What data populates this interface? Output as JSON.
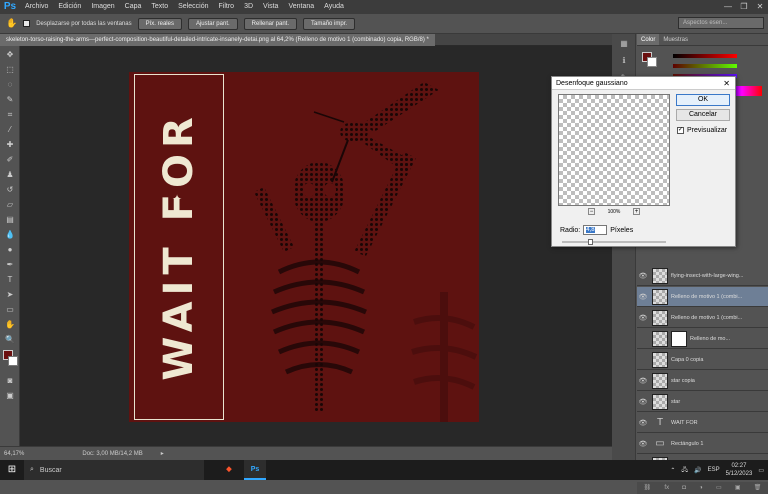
{
  "app": {
    "logo": "Ps",
    "accent": "#31a8ff"
  },
  "menu": [
    "Archivo",
    "Edición",
    "Imagen",
    "Capa",
    "Texto",
    "Selección",
    "Filtro",
    "3D",
    "Vista",
    "Ventana",
    "Ayuda"
  ],
  "window_controls": [
    "—",
    "❐",
    "✕"
  ],
  "options_bar": {
    "scroll_all_label": "Desplazarse por todas las ventanas",
    "buttons": [
      "Píx. reales",
      "Ajustar pant.",
      "Rellenar pant.",
      "Tamaño impr."
    ],
    "workspace_placeholder": "Aspectos esen..."
  },
  "document_tab": "skeleton-torso-raising-the-arms---perfect-composition-beautiful-detailed-intricate-insanely-detai.png al 64,2% (Relleno de motivo 1 (combinado) copia, RGB/8) *",
  "artwork": {
    "title_text": "WAIT FOR",
    "bg_color": "#5e1210",
    "cream": "#efe8d2"
  },
  "status": {
    "zoom": "64,17%",
    "doc": "Doc: 3,00 MB/14,2 MB"
  },
  "dialog": {
    "title": "Desenfoque gaussiano",
    "ok": "OK",
    "cancel": "Cancelar",
    "preview_label": "Previsualizar",
    "preview_checked": true,
    "zoom_pct": "100%",
    "radius_label": "Radio:",
    "radius_value": "4,8",
    "radius_unit": "Píxeles",
    "slider_position": 0.27
  },
  "color_panel": {
    "tabs": [
      "Color",
      "Muestras"
    ],
    "fg": "#6b1010",
    "bg": "#ffffff"
  },
  "layers": [
    {
      "name": "flying-insect-with-large-wing...",
      "selected": false,
      "kind": "image",
      "visible": true
    },
    {
      "name": "Relleno de motivo 1 (combi...",
      "selected": true,
      "kind": "image",
      "visible": true
    },
    {
      "name": "Relleno de motivo 1 (combi...",
      "selected": false,
      "kind": "image",
      "visible": true
    },
    {
      "name": "Relleno de mo...",
      "selected": false,
      "kind": "fill",
      "visible": false
    },
    {
      "name": "Capa 0 copia",
      "selected": false,
      "kind": "image",
      "visible": false
    },
    {
      "name": "star copia",
      "selected": false,
      "kind": "image",
      "visible": true
    },
    {
      "name": "star",
      "selected": false,
      "kind": "image",
      "visible": true
    },
    {
      "name": "WAIT FOR",
      "selected": false,
      "kind": "text",
      "visible": true
    },
    {
      "name": "Rectángulo 1",
      "selected": false,
      "kind": "shape",
      "visible": true
    },
    {
      "name": "Capa 1",
      "selected": false,
      "kind": "image",
      "visible": true
    }
  ],
  "taskbar": {
    "search_placeholder": "Buscar",
    "apps": [
      "Brave",
      "Ps"
    ],
    "language": "ESP",
    "time": "02:27",
    "date": "5/12/2023"
  }
}
